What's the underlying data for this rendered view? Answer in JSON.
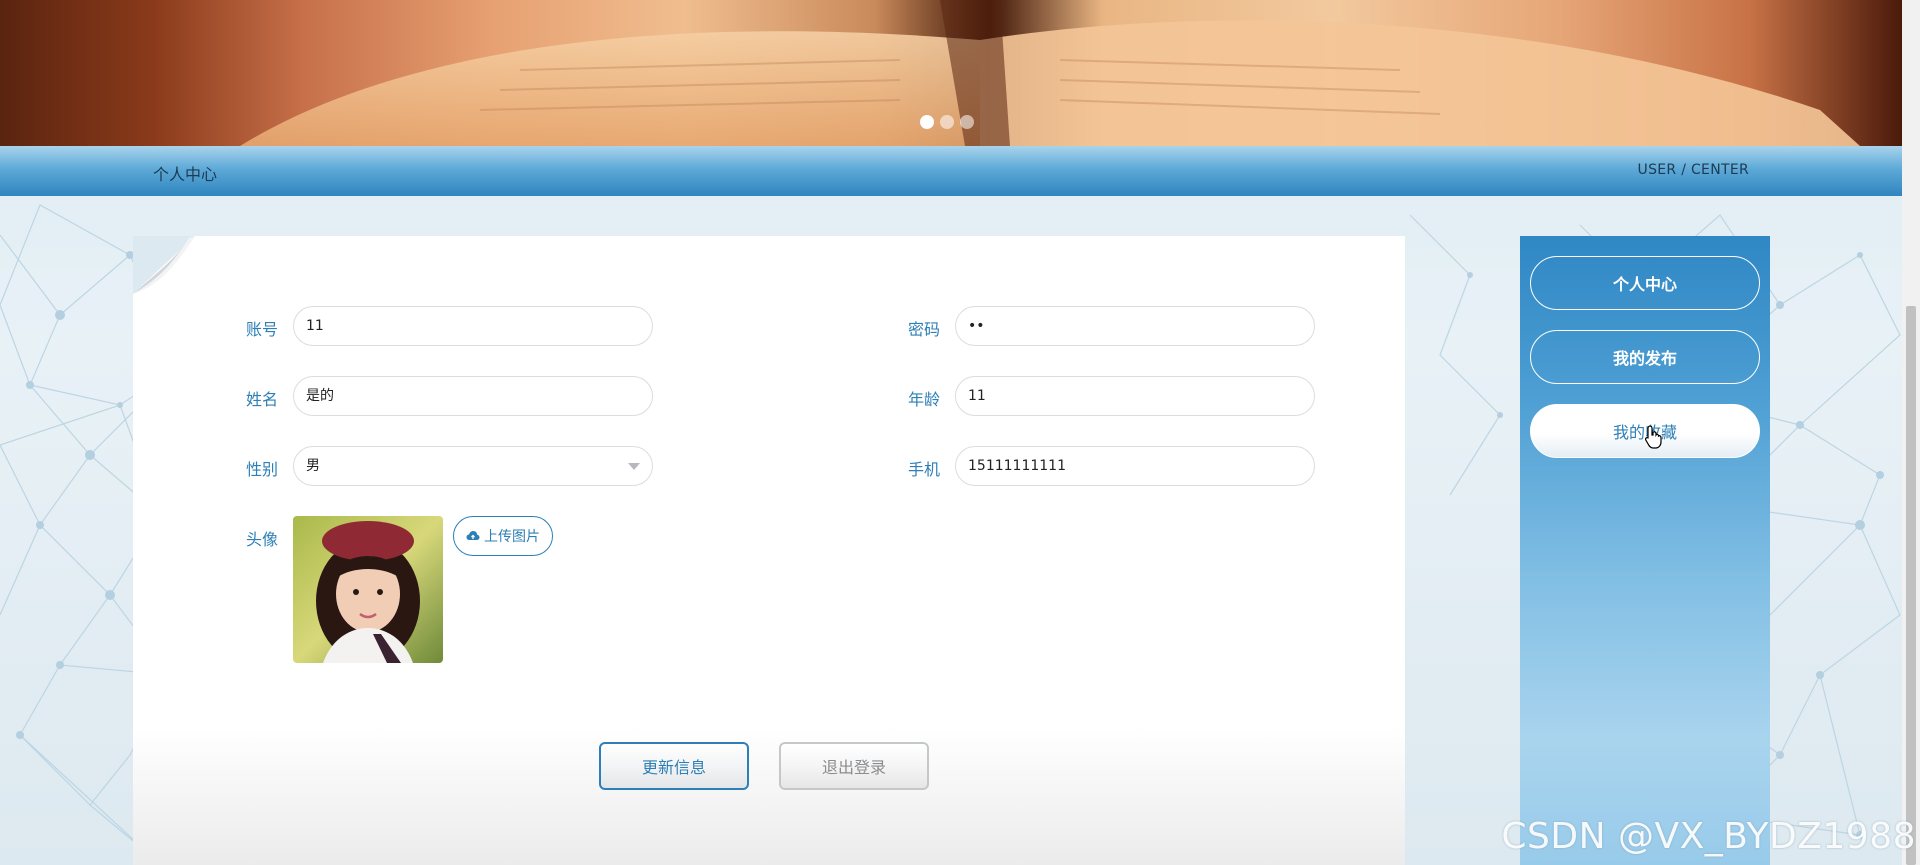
{
  "banner": {
    "slide_count": 3,
    "active_slide": 1
  },
  "title_bar": {
    "left": "个人中心",
    "right": "USER / CENTER"
  },
  "form": {
    "account": {
      "label": "账号",
      "value": "11"
    },
    "password": {
      "label": "密码",
      "value": "••"
    },
    "name": {
      "label": "姓名",
      "value": "是的"
    },
    "age": {
      "label": "年龄",
      "value": "11"
    },
    "gender": {
      "label": "性别",
      "value": "男"
    },
    "phone": {
      "label": "手机",
      "value": "15111111111"
    },
    "avatar": {
      "label": "头像",
      "upload_label": "上传图片"
    },
    "update_label": "更新信息",
    "logout_label": "退出登录"
  },
  "sidebar": {
    "items": [
      {
        "label": "个人中心"
      },
      {
        "label": "我的发布"
      },
      {
        "label": "我的收藏"
      }
    ],
    "active_index": 2
  },
  "watermark": "CSDN @VX_BYDZ1988",
  "colors": {
    "accent": "#2d7fb6",
    "title_bar": "#4c9ed3",
    "sidebar_top": "#2f87c4",
    "sidebar_bottom": "#a9d4ee",
    "logout_text": "#8a8d90"
  },
  "icons": {
    "upload": "cloud-upload-icon",
    "select": "chevron-down-icon",
    "cursor": "hand-pointer-icon"
  }
}
